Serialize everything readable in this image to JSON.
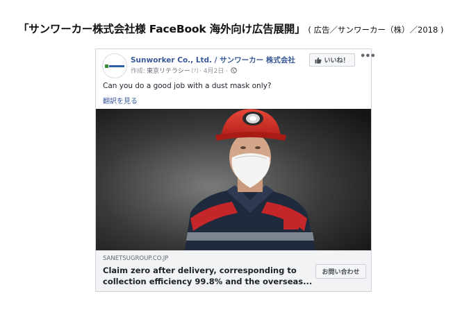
{
  "heading": {
    "main": "「サンワーカー株式会社様 FaceBook 海外向け広告展開」",
    "sub": "( 広告／サンワーカー（株）／2018 )"
  },
  "post": {
    "page_name": "Sunworker Co., Ltd. / サンワーカー 株式会社",
    "meta_prefix": "作成:",
    "meta_author": "東京リテラシー",
    "meta_help": "[?]",
    "meta_date": "· 4月2日 ·",
    "like_label": "いいね！",
    "more_label": "•••",
    "text": "Can you do a good job with a dust mask only?",
    "translate_label": "翻訳を見る"
  },
  "link": {
    "domain": "SANETSUGROUP.CO.JP",
    "headline_line1": "Claim zero after delivery, corresponding to",
    "headline_line2": "collection efficiency 99.8% and the overseas...",
    "cta_label": "お問い合わせ"
  },
  "icons": {
    "logo": "company-logo-icon",
    "globe": "globe-icon",
    "like": "thumbs-up-icon",
    "more": "more-options-icon"
  },
  "colors": {
    "link_blue": "#385898",
    "helmet_red": "#d92b24",
    "footer_gray": "#f2f3f5"
  }
}
